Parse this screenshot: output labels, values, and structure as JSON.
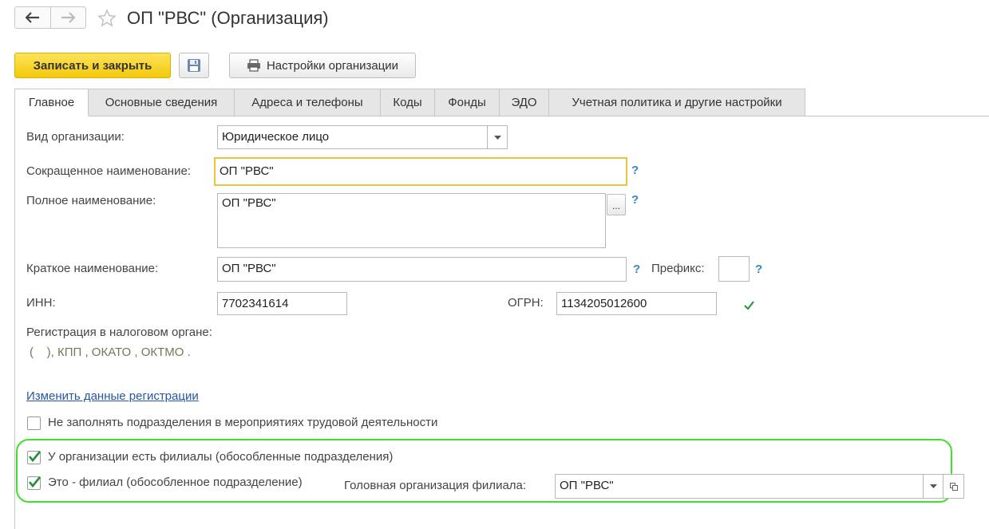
{
  "window": {
    "title": "ОП \"РВС\" (Организация)"
  },
  "toolbar": {
    "save_close_label": "Записать и закрыть",
    "settings_label": "Настройки организации"
  },
  "tabs": [
    {
      "label": "Главное"
    },
    {
      "label": "Основные сведения"
    },
    {
      "label": "Адреса и телефоны"
    },
    {
      "label": "Коды"
    },
    {
      "label": "Фонды"
    },
    {
      "label": "ЭДО"
    },
    {
      "label": "Учетная политика и другие настройки"
    }
  ],
  "form": {
    "org_type": {
      "label": "Вид организации:",
      "value": "Юридическое лицо"
    },
    "short_name": {
      "label": "Сокращенное наименование:",
      "value": "ОП \"РВС\""
    },
    "full_name": {
      "label": "Полное наименование:",
      "value": "ОП \"РВС\""
    },
    "brief_name": {
      "label": "Краткое наименование:",
      "value": "ОП \"РВС\""
    },
    "prefix": {
      "label": "Префикс:",
      "value": ""
    },
    "inn": {
      "label": "ИНН:",
      "value": "7702341614"
    },
    "ogrn": {
      "label": "ОГРН:",
      "value": "1134205012600"
    },
    "tax_registration": {
      "label": "Регистрация в налоговом органе:",
      "value": "(    ), КПП , ОКАТО , ОКТМО ."
    },
    "change_registration_link": "Изменить данные регистрации",
    "help_symbol": "?",
    "ellipsis": "...",
    "no_fill_departments": {
      "label": "Не заполнять подразделения в мероприятиях трудовой деятельности",
      "checked": false
    },
    "has_branches": {
      "label": "У организации есть филиалы (обособленные подразделения)",
      "checked": true
    },
    "is_branch": {
      "label": "Это - филиал (обособленное подразделение)",
      "checked": true
    },
    "head_org": {
      "label": "Головная организация филиала:",
      "value": "ОП \"РВС\""
    }
  },
  "colors": {
    "primary_button": "#f3c90a",
    "highlight_oval": "#3ee02a",
    "focus_border": "#f0c040",
    "check_green": "#2e9a3e",
    "link": "#2457a6"
  }
}
